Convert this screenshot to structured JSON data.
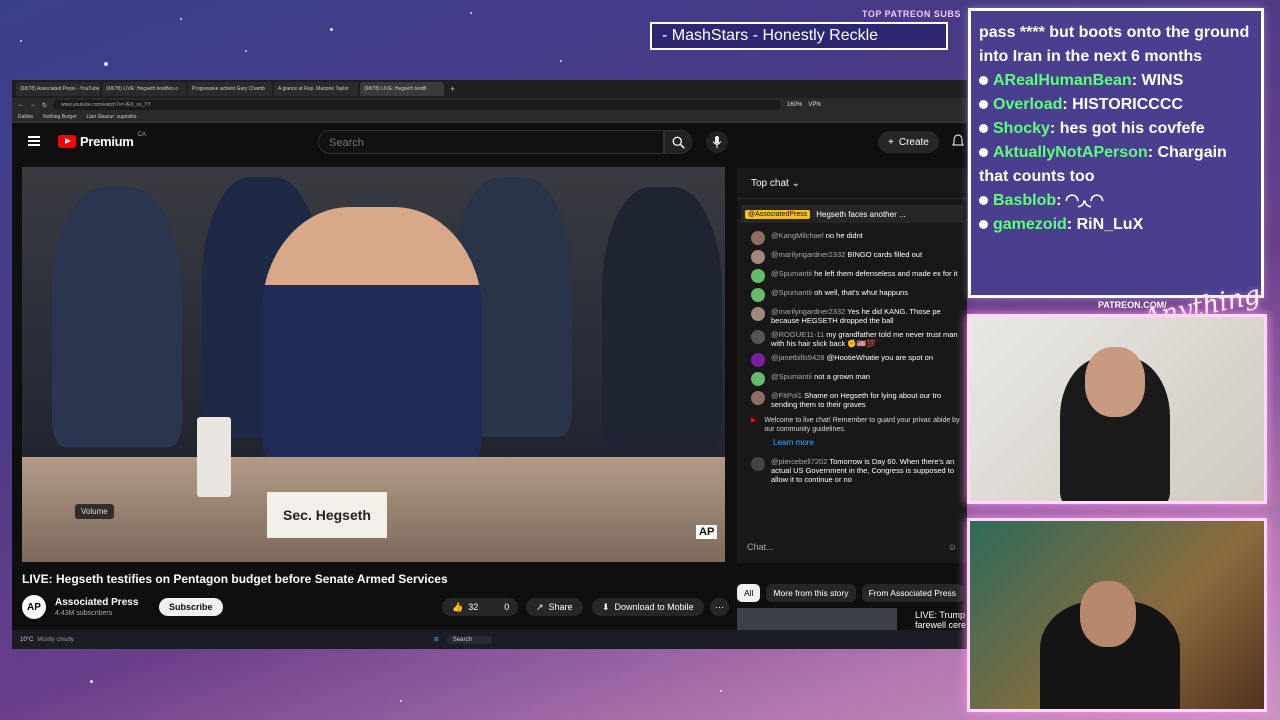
{
  "overlay": {
    "marquee_text": "- MashStars - Honestly Reckle",
    "top_patreon_label": "TOP PATREON SUBS",
    "patreon_signature": "PATREON.COM/",
    "brand_script": "Anything Else?"
  },
  "stream_chat": {
    "lines": [
      {
        "user": "",
        "text": "pass **** but boots onto the ground into Iran in the next 6 months"
      },
      {
        "user": "ARealHumanBean",
        "text": " WINS"
      },
      {
        "user": "Overload",
        "text": " HISTORICCCC"
      },
      {
        "user": "Shocky",
        "text": " hes got his covfefe"
      },
      {
        "user": "AktuallyNotAPerson",
        "text": " Chargain that counts too"
      },
      {
        "user": "Basblob",
        "text": " ◜◝◞◟◜◝"
      },
      {
        "user": "gamezoid",
        "text": " RiN_LuX"
      }
    ]
  },
  "browser": {
    "tabs": [
      "(68/78) Associated Press - YouTube",
      "(68/78) LIVE: Hegseth testifies o",
      "Progressive activist Gary Chamb",
      "A glance at Rep. Marjorie Taylor",
      "(68/78) LIVE: Hegseth testifi"
    ],
    "url": "www.youtube.com/watch?v=-fE0_so_TY",
    "zoom": "160%",
    "vpn": "VPN",
    "bookmarks": [
      "Dailies",
      "Nothing Burger",
      "Llan Gbazur: supositio"
    ]
  },
  "youtube": {
    "logo_text": "Premium",
    "logo_region": "CA",
    "search_placeholder": "Search",
    "create_label": "Create",
    "video": {
      "nameplate": "Sec. Hegseth",
      "volume_tooltip": "Volume",
      "ap_bug": "AP",
      "title": "LIVE: Hegseth testifies on Pentagon budget before Senate Armed Services"
    },
    "channel": {
      "avatar": "AP",
      "name": "Associated Press",
      "subs": "4.43M subscribers",
      "subscribe": "Subscribe"
    },
    "actions": {
      "likes": "32",
      "dislikes": "0",
      "share": "Share",
      "download": "Download to Mobile",
      "more": "⋯"
    },
    "chat": {
      "header": "Top chat",
      "pinned_user": "@AssociatedPress",
      "pinned_text": "Hegseth faces another ...",
      "messages": [
        {
          "user": "@KangMilchael",
          "text": "no he didnt",
          "color": "#8d6e63"
        },
        {
          "user": "@marilyngardner2332",
          "text": "BINGO cards filled out",
          "color": "#a1887f"
        },
        {
          "user": "@Spumantii",
          "text": "he left them defenseless and made ex for it",
          "color": "#66bb6a"
        },
        {
          "user": "@Spumantii",
          "text": "oh well, that's whut happuns",
          "color": "#66bb6a"
        },
        {
          "user": "@marilyngardner2332",
          "text": "Yes he did KANG. Those pe because HEGSETH dropped the ball",
          "color": "#a1887f"
        },
        {
          "user": "@ROGUE11-11",
          "text": "my grandfather told me never trust man with his hair slick back ✊🇺🇸💯",
          "color": "#555"
        },
        {
          "user": "@janetbills9428",
          "text": "@HootieWhatie you are spot on",
          "color": "#7b1fa2"
        },
        {
          "user": "@Spumantii",
          "text": "not a grown man",
          "color": "#66bb6a"
        },
        {
          "user": "@FitPol1",
          "text": "Shame on Hegseth for lying about our tro sending them to their graves",
          "color": "#8d6e63"
        }
      ],
      "welcome": "Welcome to live chat! Remember to guard your privac abide by our community guidelines.",
      "learn_more": "Learn more",
      "last_user": "@piercebell7202",
      "last_text": "Tomorrow is Day 60. When there's an actual US Government in the, Congress is supposed to allow it to continue or no",
      "input_placeholder": "Chat..."
    },
    "chips": [
      "All",
      "More from this story",
      "From Associated Press"
    ],
    "rec_title": "LIVE: Trump farewell cere"
  },
  "taskbar": {
    "weather_temp": "10°C",
    "weather_desc": "Mostly cloudy",
    "search": "Search"
  }
}
